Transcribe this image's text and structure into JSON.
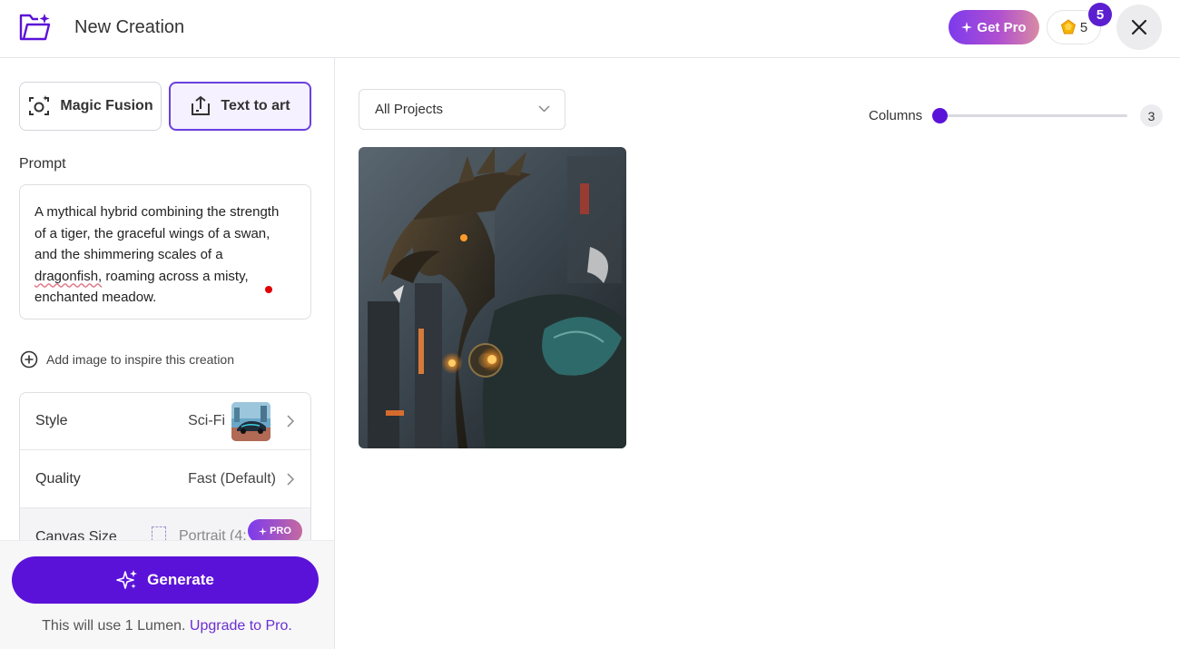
{
  "header": {
    "title": "New Creation",
    "get_pro_label": "Get Pro",
    "lumen_count": "5",
    "notification_count": "5"
  },
  "tabs": [
    {
      "label": "Magic Fusion",
      "active": false
    },
    {
      "label": "Text to art",
      "active": true
    }
  ],
  "prompt": {
    "label": "Prompt",
    "text_part1": "A mythical hybrid combining the strength of a tiger, the graceful wings of a swan, and the shimmering scales of a ",
    "text_misspelled": "dragonfish,",
    "text_part2": " roaming across a misty, enchanted meadow."
  },
  "add_image_label": "Add image to inspire this creation",
  "settings": {
    "style": {
      "label": "Style",
      "value": "Sci-Fi"
    },
    "quality": {
      "label": "Quality",
      "value": "Fast (Default)"
    },
    "canvas": {
      "label": "Canvas Size",
      "value": "Portrait (4:",
      "badge": "PRO"
    }
  },
  "generate": {
    "label": "Generate",
    "note_prefix": "This will use 1 Lumen. ",
    "note_link": "Upgrade to Pro."
  },
  "gallery": {
    "filter_value": "All Projects",
    "columns_label": "Columns",
    "columns_value": "3",
    "columns_level": 0.0
  },
  "colors": {
    "accent": "#5b12d8",
    "active_tab_border": "#6b3fe0",
    "link": "#6b2fd0"
  },
  "icons": [
    "folder-sparkle-icon",
    "sparkle-icon",
    "gem-icon",
    "close-icon",
    "camera-fusion-icon",
    "upload-art-icon",
    "plus-circle-icon",
    "chevron-right-icon",
    "chevron-down-icon",
    "generate-sparkle-icon",
    "canvas-frame-icon"
  ]
}
